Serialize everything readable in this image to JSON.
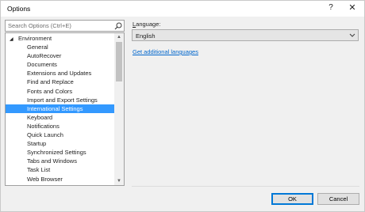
{
  "window": {
    "title": "Options",
    "help_glyph": "?",
    "close_glyph": "✕"
  },
  "search": {
    "placeholder": "Search Options (Ctrl+E)"
  },
  "tree": {
    "root": {
      "label": "Environment",
      "expander": "◢",
      "expanded": true
    },
    "items": [
      {
        "label": "General"
      },
      {
        "label": "AutoRecover"
      },
      {
        "label": "Documents"
      },
      {
        "label": "Extensions and Updates"
      },
      {
        "label": "Find and Replace"
      },
      {
        "label": "Fonts and Colors"
      },
      {
        "label": "Import and Export Settings"
      },
      {
        "label": "International Settings",
        "selected": true
      },
      {
        "label": "Keyboard"
      },
      {
        "label": "Notifications"
      },
      {
        "label": "Quick Launch"
      },
      {
        "label": "Startup"
      },
      {
        "label": "Synchronized Settings"
      },
      {
        "label": "Tabs and Windows"
      },
      {
        "label": "Task List"
      },
      {
        "label": "Web Browser"
      }
    ],
    "scroll_up": "▲",
    "scroll_down": "▼"
  },
  "language": {
    "label_accel": "L",
    "label_rest": "anguage:",
    "selected": "English",
    "more_link": "Get additional languages"
  },
  "buttons": {
    "ok": "OK",
    "cancel": "Cancel"
  },
  "colors": {
    "selection": "#3399ff",
    "link": "#0066cc",
    "ok_border": "#0078d7"
  }
}
